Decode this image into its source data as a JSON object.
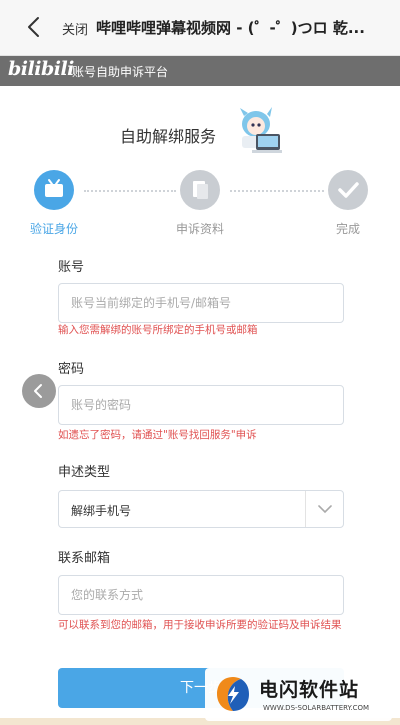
{
  "browser": {
    "close_label": "关闭",
    "page_title": "哔哩哔哩弹幕视频网 - (゜-゜)つロ 乾..."
  },
  "brand": {
    "logo_text": "bilibili",
    "platform_name": "账号自助申诉平台"
  },
  "form": {
    "title": "自助解绑服务",
    "steps": [
      {
        "label": "验证身份",
        "state": "active"
      },
      {
        "label": "申诉资料",
        "state": "pending"
      },
      {
        "label": "完成",
        "state": "pending"
      }
    ],
    "account": {
      "label": "账号",
      "placeholder": "账号当前绑定的手机号/邮箱号",
      "hint": "输入您需解绑的账号所绑定的手机号或邮箱"
    },
    "password": {
      "label": "密码",
      "placeholder": "账号的密码",
      "hint": "如遗忘了密码，请通过\"账号找回服务\"申诉"
    },
    "complaint_type": {
      "label": "申述类型",
      "value": "解绑手机号"
    },
    "email": {
      "label": "联系邮箱",
      "placeholder": "您的联系方式",
      "hint": "可以联系到您的邮箱，用于接收申诉所要的验证码及申诉结果"
    },
    "submit_label": "下一步"
  },
  "watermark": {
    "name": "电闪软件站",
    "url": "WWW.DS-SOLARBATTERY.COM"
  },
  "colors": {
    "accent": "#4aa6e6",
    "error": "#e05252",
    "step_pending": "#c9cdd2",
    "brand_bar": "#6e6e6e"
  },
  "icons": [
    "back-arrow-icon",
    "tv-icon",
    "document-icon",
    "checkmark-icon",
    "chevron-down-icon",
    "chevron-left-icon",
    "lightning-logo-icon"
  ]
}
